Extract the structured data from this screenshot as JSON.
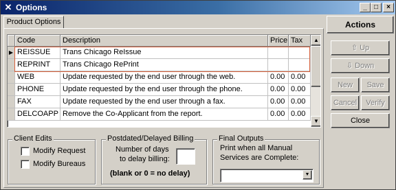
{
  "window": {
    "title": "Options",
    "icon": "x-app-icon",
    "controls": [
      "_",
      "□",
      "×"
    ]
  },
  "tab": {
    "label": "Product Options"
  },
  "grid": {
    "columns": [
      "Code",
      "Description",
      "Price",
      "Tax"
    ],
    "rows": [
      {
        "indicator": "▶",
        "code": "REISSUE",
        "description": "Trans Chicago ReIssue",
        "price": "",
        "tax": ""
      },
      {
        "indicator": "",
        "code": "REPRINT",
        "description": "Trans Chicago RePrint",
        "price": "",
        "tax": ""
      },
      {
        "indicator": "",
        "code": "WEB",
        "description": "Update requested by the end user through the web.",
        "price": "0.00",
        "tax": "0.00"
      },
      {
        "indicator": "",
        "code": "PHONE",
        "description": "Update requested by the end user through the phone.",
        "price": "0.00",
        "tax": "0.00"
      },
      {
        "indicator": "",
        "code": "FAX",
        "description": "Update requested by the end user through a fax.",
        "price": "0.00",
        "tax": "0.00"
      },
      {
        "indicator": "",
        "code": "DELCOAPP",
        "description": "Remove the Co-Applicant from the report.",
        "price": "0.00",
        "tax": "0.00"
      }
    ]
  },
  "client_edits": {
    "title": "Client Edits",
    "modify_request": "Modify Request",
    "modify_bureaus": "Modify Bureaus"
  },
  "billing": {
    "title": "Postdated/Delayed Billing",
    "line1": "Number of days",
    "line2": "to delay billing:",
    "days_value": "",
    "note": "(blank or 0 = no delay)"
  },
  "final_outputs": {
    "title": "Final Outputs",
    "line1": "Print when all Manual",
    "line2": "Services are Complete:",
    "selected": ""
  },
  "actions": {
    "title": "Actions",
    "up": "Up",
    "down": "Down",
    "new": "New",
    "save": "Save",
    "cancel": "Cancel",
    "verify": "Verify",
    "close": "Close"
  }
}
